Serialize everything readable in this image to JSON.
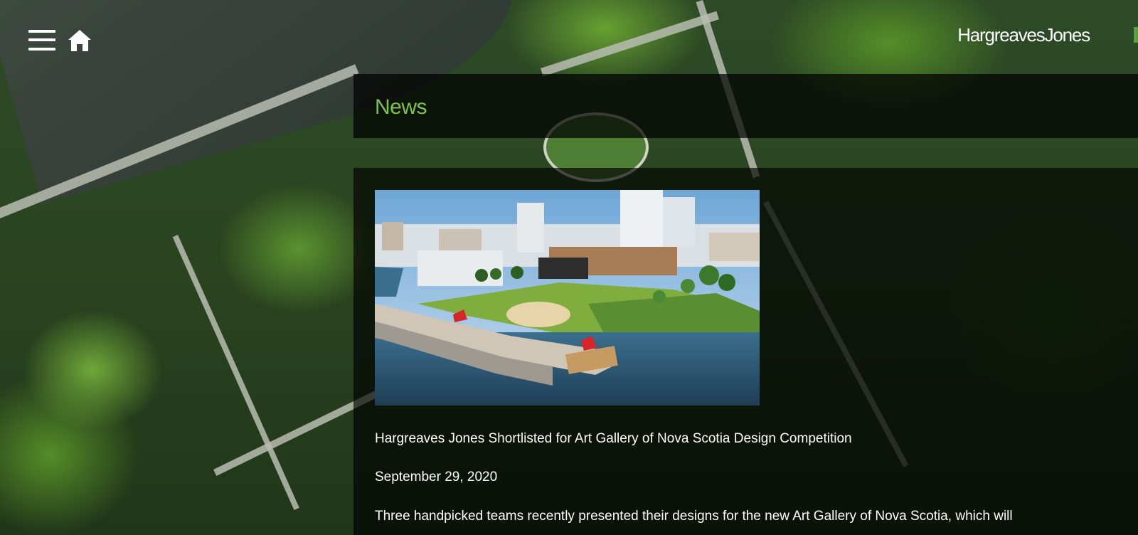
{
  "header": {
    "menu_icon": "hamburger-menu-icon",
    "home_icon": "home-icon",
    "brand": "HargreavesJones"
  },
  "news": {
    "heading": "News",
    "accent_color": "#7ec34a"
  },
  "article": {
    "image_description_icon": "project-rendering-image",
    "title": "Hargreaves Jones Shortlisted for Art Gallery of Nova Scotia Design Competition",
    "date": "September 29, 2020",
    "excerpt": "Three handpicked teams recently presented their designs for the new Art Gallery of Nova Scotia, which will"
  }
}
